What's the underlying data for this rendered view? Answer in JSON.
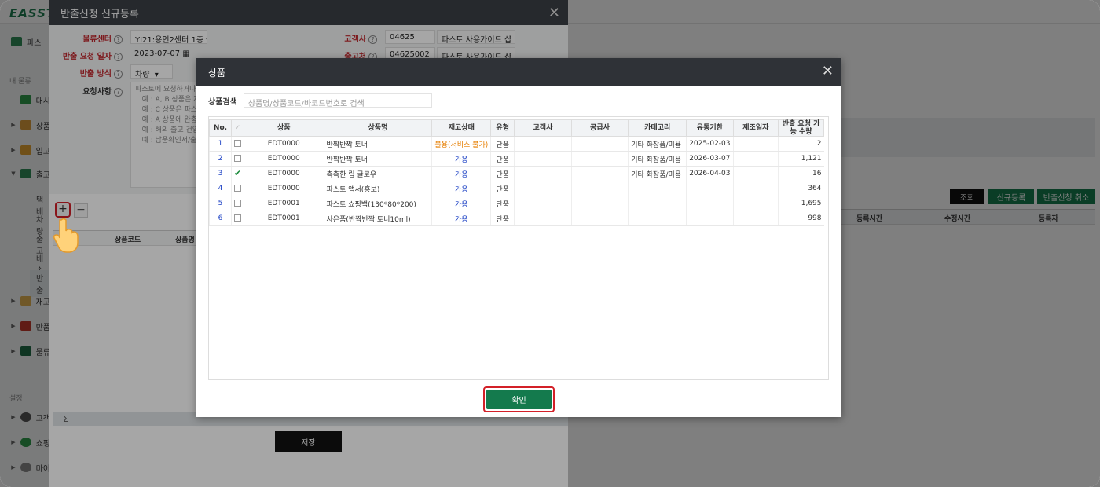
{
  "app": {
    "logo": "EASST",
    "sidebar": {
      "top_item": "파스",
      "section_my": "내 물류",
      "items": [
        "대시",
        "상품",
        "입고",
        "출고",
        "재고",
        "반품",
        "물류"
      ],
      "sub_items": [
        "택배",
        "차량",
        "출고",
        "배송",
        "반출"
      ],
      "section_settings": "설정",
      "settings_items": [
        "고객",
        "쇼핑",
        "마이"
      ]
    },
    "right": {
      "btn_search": "조회",
      "btn_new": "신규등록",
      "btn_cancel": "반출신청 취소",
      "col_created": "등록시간",
      "col_modified": "수정시간",
      "col_registrant": "등록자"
    },
    "colors": {
      "brand": "#147a4d",
      "required": "#c0272d",
      "highlight": "#d32028"
    }
  },
  "modal1": {
    "title": "반출신청 신규등록",
    "close": "✕",
    "fields": {
      "center_label": "물류센터",
      "center_value": "YI21:용인2센터 1층",
      "date_label": "반출 요청 일자",
      "date_value": "2023-07-07",
      "method_label": "반출 방식",
      "method_value": "차량",
      "request_label": "요청사항",
      "customer_label": "고객사",
      "customer_code": "04625",
      "customer_name": "파스토 사용가이드 샵",
      "shipto_label": "출고처",
      "shipto_code": "04625002",
      "shipto_name": "파스토 사용가이드 샵"
    },
    "memo_text": "파스토에 요청하거나 \n   예 : A, B 상품은 지\n   예 : C 상품은 파스\n   예 : A 상품에 완충\n   예 : 해외 출고 건입\n   예 : 납품확인서/출고",
    "grid": {
      "col_code": "상품코드",
      "col_name": "상품명"
    },
    "sigma": "Σ",
    "save": "저장",
    "plus": "+",
    "minus": "−"
  },
  "modal2": {
    "title": "상품",
    "close": "✕",
    "search_label": "상품검색",
    "search_placeholder": "상품명/상품코드/바코드번호로 검색",
    "columns": [
      "No.",
      "✓",
      "상품",
      "상품명",
      "재고상태",
      "유형",
      "고객사",
      "공급사",
      "카테고리",
      "유통기한",
      "제조일자",
      "반출 요청 가능 수량"
    ],
    "rows": [
      {
        "no": "1",
        "checked": false,
        "code": "EDT0000",
        "name": "반짝반짝 토너",
        "stock": "불용(서비스 불가)",
        "stock_color": "#e67e00",
        "type": "단품",
        "customer": "",
        "supplier": "",
        "category": "기타 화장품/미용",
        "expiry": "2025-02-03",
        "mfg": "",
        "qty": "2"
      },
      {
        "no": "2",
        "checked": false,
        "code": "EDT0000",
        "name": "반짝반짝 토너",
        "stock": "가용",
        "stock_color": "#1a3fc4",
        "type": "단품",
        "customer": "",
        "supplier": "",
        "category": "기타 화장품/미용",
        "expiry": "2026-03-07",
        "mfg": "",
        "qty": "1,121"
      },
      {
        "no": "3",
        "checked": true,
        "code": "EDT0000",
        "name": "촉촉한 립 글로우",
        "stock": "가용",
        "stock_color": "#1a3fc4",
        "type": "단품",
        "customer": "",
        "supplier": "",
        "category": "기타 화장품/미용",
        "expiry": "2026-04-03",
        "mfg": "",
        "qty": "16"
      },
      {
        "no": "4",
        "checked": false,
        "code": "EDT0000",
        "name": "파스토 앱서(홍보)",
        "stock": "가용",
        "stock_color": "#1a3fc4",
        "type": "단품",
        "customer": "",
        "supplier": "",
        "category": "",
        "expiry": "",
        "mfg": "",
        "qty": "364"
      },
      {
        "no": "5",
        "checked": false,
        "code": "EDT0001",
        "name": "파스토 쇼핑백(130*80*200)",
        "stock": "가용",
        "stock_color": "#1a3fc4",
        "type": "단품",
        "customer": "",
        "supplier": "",
        "category": "",
        "expiry": "",
        "mfg": "",
        "qty": "1,695"
      },
      {
        "no": "6",
        "checked": false,
        "code": "EDT0001",
        "name": "사은품(반짝반짝 토너10ml)",
        "stock": "가용",
        "stock_color": "#1a3fc4",
        "type": "단품",
        "customer": "",
        "supplier": "",
        "category": "",
        "expiry": "",
        "mfg": "",
        "qty": "998"
      }
    ],
    "confirm": "확인"
  }
}
